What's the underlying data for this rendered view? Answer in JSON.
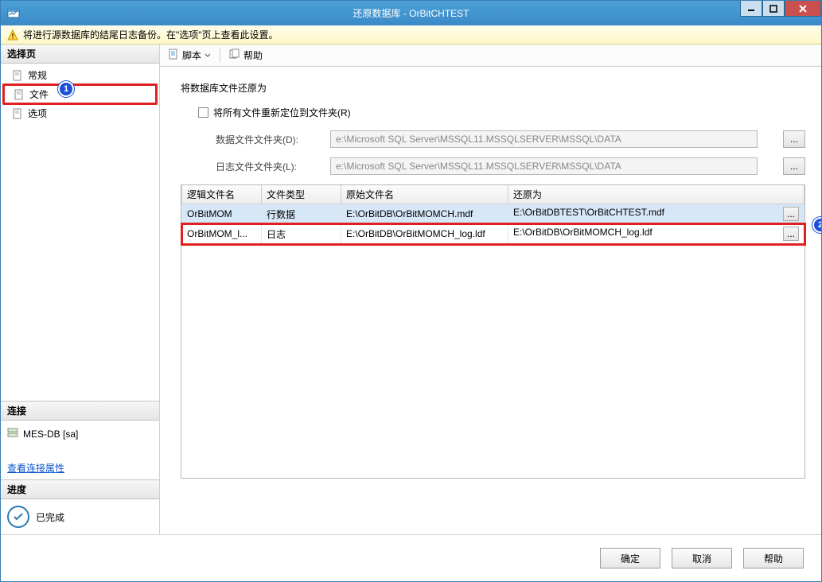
{
  "titlebar": {
    "title": "还原数据库 - OrBitCHTEST"
  },
  "infobar": {
    "message": "将进行源数据库的结尾日志备份。在\"选项\"页上查看此设置。"
  },
  "sidebar": {
    "select_page_header": "选择页",
    "items": [
      {
        "label": "常规"
      },
      {
        "label": "文件"
      },
      {
        "label": "选项"
      }
    ],
    "connection_header": "连接",
    "connection_value": "MES-DB [sa]",
    "view_conn_props": "查看连接属性",
    "progress_header": "进度",
    "progress_status": "已完成"
  },
  "toolbar": {
    "script": "脚本",
    "help": "帮助"
  },
  "main": {
    "section_title": "将数据库文件还原为",
    "relocate_checkbox": "将所有文件重新定位到文件夹(R)",
    "data_folder_label": "数据文件文件夹(D):",
    "data_folder_value": "e:\\Microsoft SQL Server\\MSSQL11.MSSQLSERVER\\MSSQL\\DATA",
    "log_folder_label": "日志文件文件夹(L):",
    "log_folder_value": "e:\\Microsoft SQL Server\\MSSQL11.MSSQLSERVER\\MSSQL\\DATA",
    "browse": "...",
    "table": {
      "headers": {
        "logical": "逻辑文件名",
        "type": "文件类型",
        "original": "原始文件名",
        "restore_as": "还原为"
      },
      "rows": [
        {
          "logical": "OrBitMOM",
          "type": "行数据",
          "original": "E:\\OrBitDB\\OrBitMOMCH.mdf",
          "restore_as": "E:\\OrBitDBTEST\\OrBitCHTEST.mdf"
        },
        {
          "logical": "OrBitMOM_l...",
          "type": "日志",
          "original": "E:\\OrBitDB\\OrBitMOMCH_log.ldf",
          "restore_as": "E:\\OrBitDB\\OrBitMOMCH_log.ldf"
        }
      ]
    }
  },
  "footer": {
    "ok": "确定",
    "cancel": "取消",
    "help": "帮助"
  },
  "annotations": {
    "one": "1",
    "two": "2"
  }
}
